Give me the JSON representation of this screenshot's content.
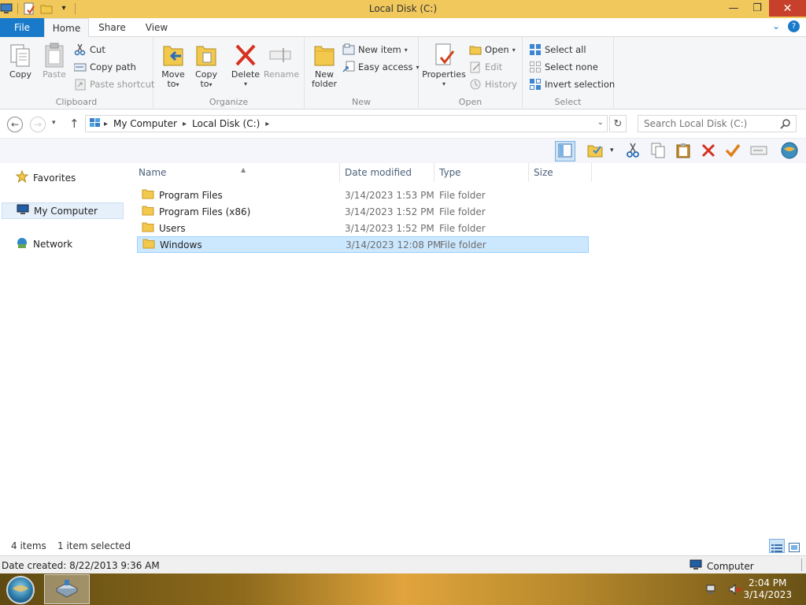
{
  "window": {
    "title": "Local Disk (C:)",
    "controls": {
      "minimize": "—",
      "maximize": "❐",
      "close": "✕"
    }
  },
  "ribbon_tabs": {
    "file": "File",
    "home": "Home",
    "share": "Share",
    "view": "View"
  },
  "ribbon": {
    "clipboard": {
      "label": "Clipboard",
      "copy": "Copy",
      "paste": "Paste",
      "cut": "Cut",
      "copy_path": "Copy path",
      "paste_shortcut": "Paste shortcut"
    },
    "organize": {
      "label": "Organize",
      "move_to": [
        "Move",
        "to"
      ],
      "copy_to": [
        "Copy",
        "to"
      ],
      "delete": "Delete",
      "rename": "Rename"
    },
    "new": {
      "label": "New",
      "new_folder": [
        "New",
        "folder"
      ],
      "new_item": "New item",
      "easy_access": "Easy access"
    },
    "open": {
      "label": "Open",
      "properties": "Properties",
      "open": "Open",
      "edit": "Edit",
      "history": "History"
    },
    "select": {
      "label": "Select",
      "select_all": "Select all",
      "select_none": "Select none",
      "invert_selection": "Invert selection"
    }
  },
  "address": {
    "breadcrumbs": [
      "My Computer",
      "Local Disk (C:)"
    ],
    "search_placeholder": "Search Local Disk (C:)"
  },
  "nav_pane": {
    "favorites": "Favorites",
    "my_computer": "My Computer",
    "network": "Network"
  },
  "columns": {
    "name": "Name",
    "date_modified": "Date modified",
    "type": "Type",
    "size": "Size"
  },
  "files": [
    {
      "name": "Program Files",
      "date": "3/14/2023 1:53 PM",
      "type": "File folder",
      "selected": false
    },
    {
      "name": "Program Files (x86)",
      "date": "3/14/2023 1:52 PM",
      "type": "File folder",
      "selected": false
    },
    {
      "name": "Users",
      "date": "3/14/2023 1:52 PM",
      "type": "File folder",
      "selected": false
    },
    {
      "name": "Windows",
      "date": "3/14/2023 12:08 PM",
      "type": "File folder",
      "selected": true
    }
  ],
  "status": {
    "item_count": "4 items",
    "selection": "1 item selected"
  },
  "details": {
    "date_created": "Date created: 8/22/2013 9:36 AM",
    "location": "Computer"
  },
  "taskbar": {
    "time": "2:04 PM",
    "date": "3/14/2023"
  },
  "colors": {
    "title_bar": "#f0c85c",
    "file_tab": "#1979ca",
    "selection": "#cce8ff",
    "close_button": "#c7402c"
  }
}
